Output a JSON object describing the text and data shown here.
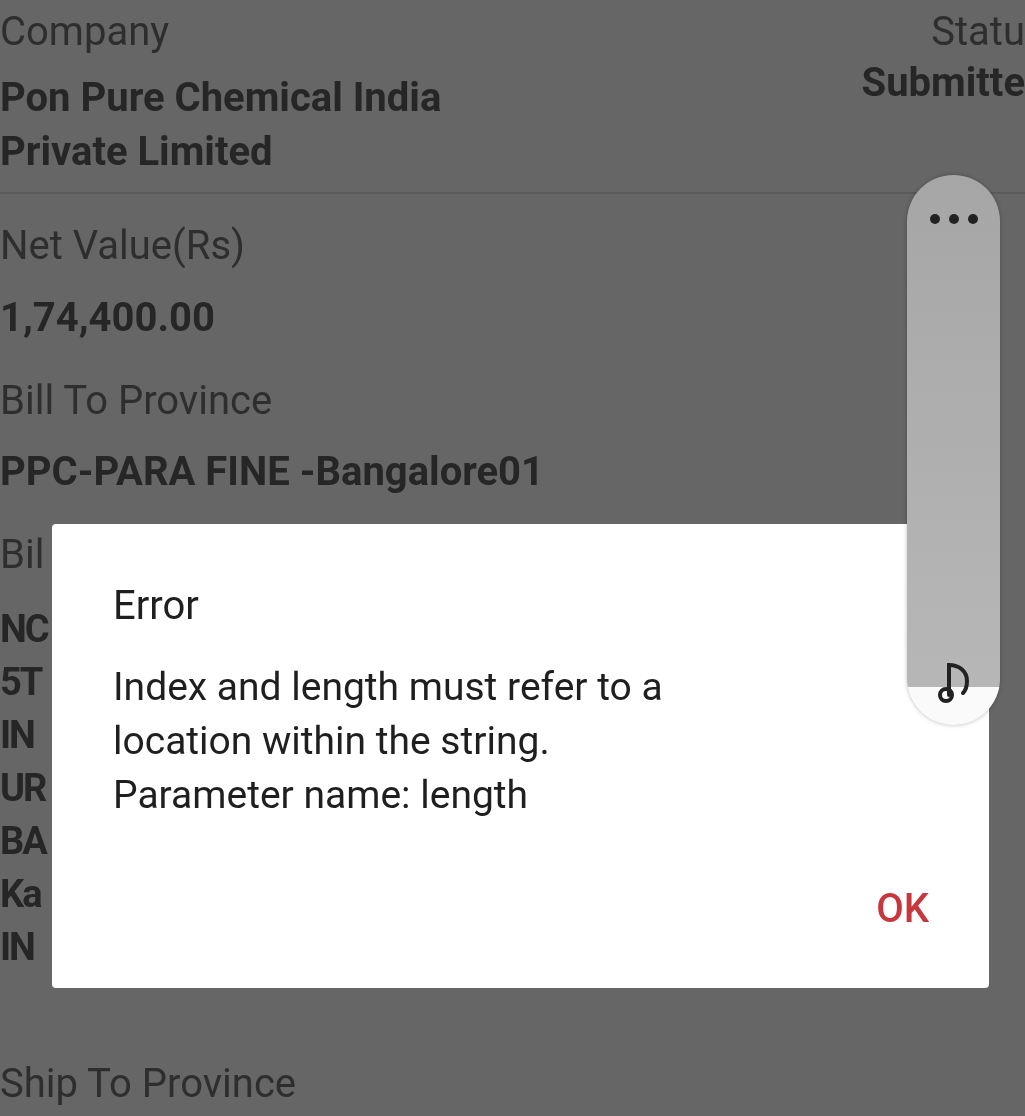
{
  "details": {
    "company": {
      "label": "Company",
      "value": "Pon Pure Chemical India Private Limited"
    },
    "status": {
      "label": "Statu",
      "value": "Submitte"
    },
    "fields": [
      {
        "label": "Net Value(Rs)",
        "value": "1,74,400.00"
      },
      {
        "label": "Bill To Province",
        "value": "PPC-PARA FINE -Bangalore01"
      }
    ],
    "partial_field": {
      "label": "Bil",
      "lines": [
        "NC",
        "5T",
        "IN",
        "UR",
        "BA",
        "Ka",
        "IN"
      ]
    },
    "next_field": {
      "label": "Ship To Province"
    }
  },
  "dialog": {
    "title": "Error",
    "message": [
      "Index and length must refer to a location within the string.",
      "Parameter name: length"
    ],
    "button": "OK"
  },
  "volume_panel": {
    "level": 0.07
  }
}
